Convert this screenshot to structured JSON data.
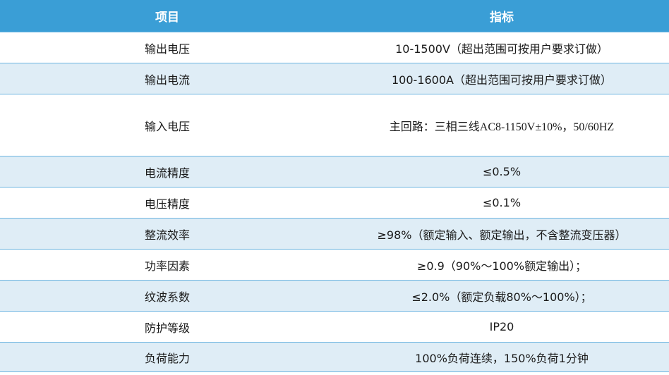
{
  "header": {
    "item": "项目",
    "spec": "指标"
  },
  "rows": [
    {
      "item": "输出电压",
      "spec": "10-1500V（超出范围可按用户要求订做）"
    },
    {
      "item": "输出电流",
      "spec": "100-1600A（超出范围可按用户要求订做）"
    },
    {
      "item": "输入电压",
      "spec": "主回路：三相三线AC8-1150V±10%，50/60HZ"
    },
    {
      "item": "电流精度",
      "spec": "≤0.5%"
    },
    {
      "item": "电压精度",
      "spec": "≤0.1%"
    },
    {
      "item": "整流效率",
      "spec": "≥98%（额定输入、额定输出，不含整流变压器）"
    },
    {
      "item": "功率因素",
      "spec": "≥0.9（90%～100%额定输出）；"
    },
    {
      "item": "纹波系数",
      "spec": "≤2.0%（额定负载80%～100%）；"
    },
    {
      "item": "防护等级",
      "spec": "IP20"
    },
    {
      "item": "负荷能力",
      "spec": "100%负荷连续，150%负荷1分钟"
    }
  ]
}
